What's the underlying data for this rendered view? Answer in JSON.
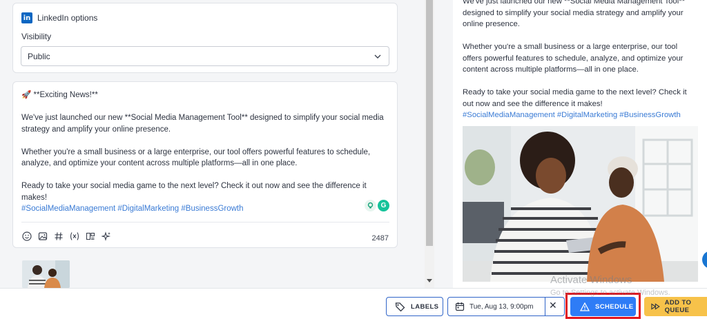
{
  "linkedin_options": {
    "title": "LinkedIn options",
    "visibility_label": "Visibility",
    "visibility_value": "Public"
  },
  "post": {
    "headline": "🚀 **Exciting News!**",
    "para1": "We've just launched our new **Social Media Management Tool** designed to simplify your social media strategy and amplify your online presence.",
    "para2": "Whether you're a small business or a large enterprise, our tool offers powerful features to schedule, analyze, and optimize your content across multiple platforms—all in one place.",
    "para3": "Ready to take your social media game to the next level? Check it out now and see the difference it makes!",
    "hashtags": "#SocialMediaManagement #DigitalMarketing #BusinessGrowth",
    "char_count": "2487",
    "grammarly_letter": "G"
  },
  "preview": {
    "para1": "We've just launched our new **Social Media Management Tool** designed to simplify your social media strategy and amplify your online presence.",
    "para2": "Whether you're a small business or a large enterprise, our tool offers powerful features to schedule, analyze, and optimize your content across multiple platforms—all in one place.",
    "para3": "Ready to take your social media game to the next level? Check it out now and see the difference it makes!",
    "hashtags": "#SocialMediaManagement #DigitalMarketing #BusinessGrowth"
  },
  "action_bar": {
    "labels": "LABELS",
    "date": "Tue, Aug 13, 9:00pm",
    "schedule": "SCHEDULE",
    "add_to_queue": "ADD TO QUEUE"
  },
  "watermark": {
    "title": "Activate Windows",
    "subtitle": "Go to Settings to activate Windows."
  },
  "colors": {
    "accent": "#2e7cf6",
    "link": "#3a7bd5",
    "queue": "#f7c24a",
    "highlight": "#e0141e",
    "linkedin": "#0a66c2"
  }
}
